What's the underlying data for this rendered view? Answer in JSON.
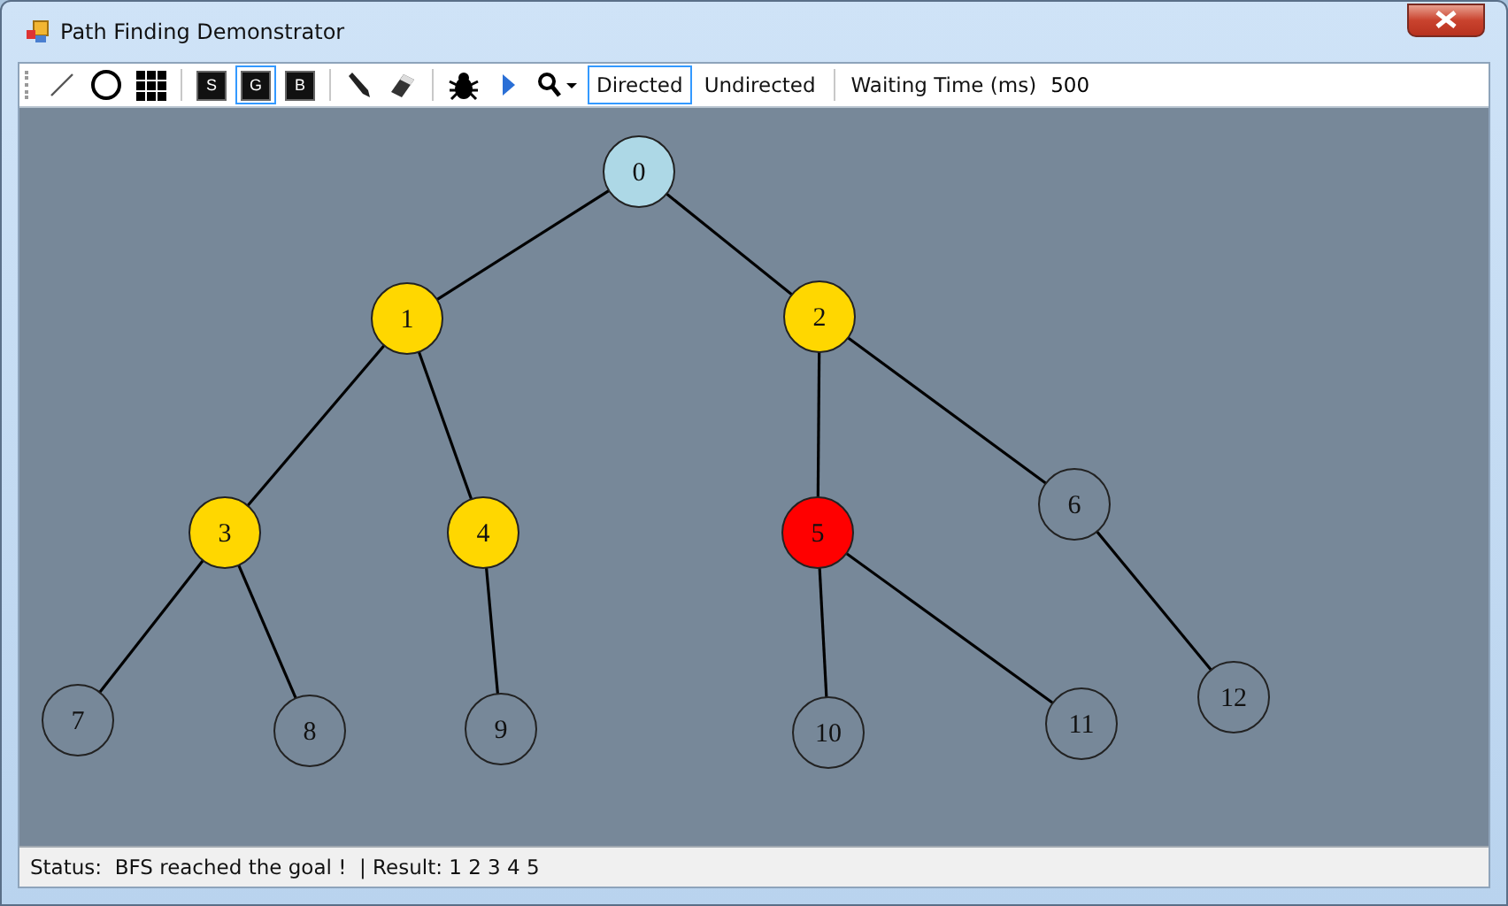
{
  "window": {
    "title": "Path Finding Demonstrator"
  },
  "toolbar": {
    "tools": [
      {
        "kind": "line",
        "selected": false
      },
      {
        "kind": "circle",
        "selected": false
      },
      {
        "kind": "grid",
        "selected": false
      },
      {
        "kind": "letter",
        "label": "S",
        "selected": false
      },
      {
        "kind": "letter",
        "label": "G",
        "selected": true
      },
      {
        "kind": "letter",
        "label": "B",
        "selected": false
      },
      {
        "kind": "pen",
        "selected": false
      },
      {
        "kind": "eraser",
        "selected": false
      },
      {
        "kind": "bug",
        "selected": false
      },
      {
        "kind": "play",
        "selected": false
      },
      {
        "kind": "zoom",
        "selected": false
      }
    ],
    "modes": [
      {
        "label": "Directed",
        "selected": true
      },
      {
        "label": "Undirected",
        "selected": false
      }
    ],
    "waiting_time": {
      "label": "Waiting Time (ms)",
      "value": "500"
    }
  },
  "graph": {
    "root": {
      "label": "0",
      "color": "#add8e6",
      "children": [
        {
          "label": "1",
          "color": "#ffd700",
          "children": [
            {
              "label": "3",
              "color": "#ffd700",
              "children": [
                {
                  "label": "7",
                  "color": "#778899"
                },
                {
                  "label": "8",
                  "color": "#778899"
                }
              ]
            },
            {
              "label": "4",
              "color": "#ffd700",
              "children": [
                {
                  "label": "9",
                  "color": "#778899"
                }
              ]
            }
          ]
        },
        {
          "label": "2",
          "color": "#ffd700",
          "children": [
            {
              "label": "5",
              "color": "#ff0000",
              "children": [
                {
                  "label": "10",
                  "color": "#778899"
                },
                {
                  "label": "11",
                  "color": "#778899"
                }
              ]
            },
            {
              "label": "6",
              "color": "#778899",
              "children": [
                {
                  "label": "12",
                  "color": "#778899"
                }
              ]
            }
          ]
        }
      ]
    }
  },
  "status_bar": {
    "status": "Status:  BFS reached the goal !  | Result: 1 2 3 4 5"
  }
}
